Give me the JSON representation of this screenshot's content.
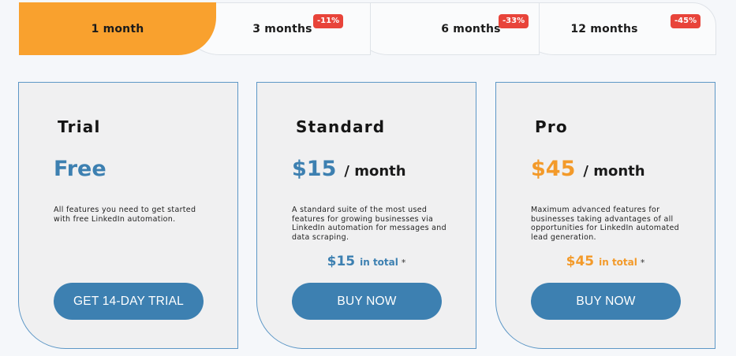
{
  "tabs": [
    {
      "label": "1 month",
      "badge": ""
    },
    {
      "label": "3 months",
      "badge": "-11%"
    },
    {
      "label": "6 months",
      "badge": "-33%"
    },
    {
      "label": "12 months",
      "badge": "-45%"
    }
  ],
  "active_tab": "1 month",
  "plans": [
    {
      "name": "Trial",
      "price": "Free",
      "per": "",
      "description": "All features you need to get started with free LinkedIn automation.",
      "total_price": "",
      "total_label": "",
      "total_star": "",
      "button": "GET 14-DAY TRIAL"
    },
    {
      "name": "Standard",
      "price": "$15",
      "per": "/ month",
      "description": "A standard suite of the most used features for growing businesses via LinkedIn automation for messages and data scraping.",
      "total_price": "$15",
      "total_label": "in total",
      "total_star": "*",
      "button": "BUY NOW"
    },
    {
      "name": "Pro",
      "price": "$45",
      "per": "/ month",
      "description": "Maximum advanced features for businesses taking advantages of all opportunities for LinkedIn automated lead generation.",
      "total_price": "$45",
      "total_label": "in total",
      "total_star": "*",
      "button": "BUY NOW"
    }
  ],
  "colors": {
    "accent_orange": "#f9a12e",
    "brand_blue": "#3d80b1",
    "badge_red": "#e8443a"
  }
}
